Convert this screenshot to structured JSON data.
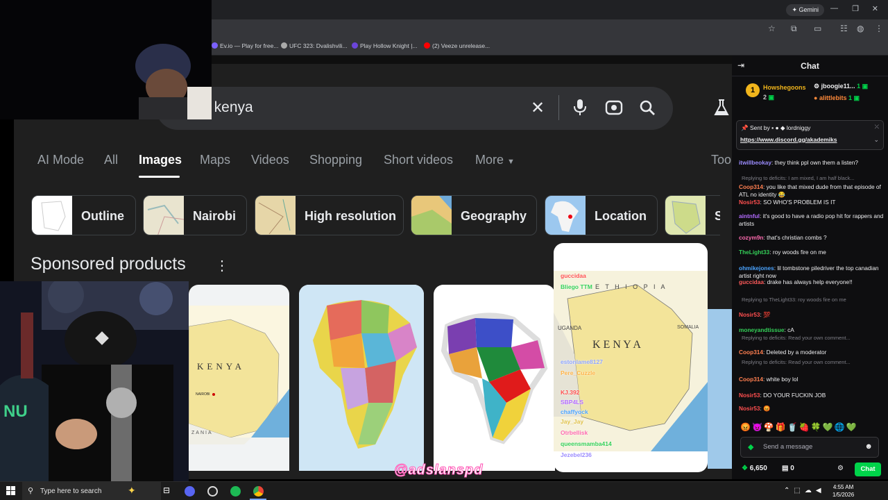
{
  "browser": {
    "gemini_label": "Gemini",
    "bookmarks": [
      {
        "label": "Ev.io — Play for free...",
        "color": "#7b61ff"
      },
      {
        "label": "UFC 323: Dvalishvili...",
        "color": "#aaaaaa"
      },
      {
        "label": "Play Hollow Knight |...",
        "color": "#6b45d9"
      },
      {
        "label": "(2) Veeze unrelease...",
        "color": "#ff0000"
      }
    ]
  },
  "search": {
    "query": "f kenya",
    "tabs": [
      "AI Mode",
      "All",
      "Images",
      "Maps",
      "Videos",
      "Shopping",
      "Short videos",
      "More",
      "Too"
    ],
    "active_tab": "Images",
    "chips": [
      "Outline",
      "Nairobi",
      "High resolution",
      "Geography",
      "Location",
      "Sin"
    ],
    "sponsored_title": "Sponsored products",
    "card_labels": {
      "kenya": "KENYA",
      "kenya_big": "K E N Y A",
      "ethiopia": "E T H I O P I A",
      "uganda": "UGANDA",
      "somalia": "SOMALIA",
      "nairobi": "NAIROBI",
      "tanzania": "ZANIA"
    }
  },
  "chat": {
    "title": "Chat",
    "gifter_top": {
      "rank": "1",
      "name": "Howshegoons",
      "count": "2"
    },
    "gifters_right": [
      {
        "name": "jboogie11...",
        "count": "1"
      },
      {
        "name": "alittlebits",
        "count": "1"
      }
    ],
    "pinned": {
      "sent_by": "Sent by",
      "sender": "lordniggy",
      "link": "https://www.discord.gg/akademiks"
    },
    "messages": [
      {
        "user": "itwillbeokay",
        "color": "#9b8cff",
        "text": "they think ppl own them a listen?"
      },
      {
        "reply": "Replying to deficits: I am mixed, I am half black..."
      },
      {
        "user": "Coop314",
        "color": "#ff7f50",
        "text": "you like that mixed dude from that episode of ATL no identity 😂"
      },
      {
        "user": "Nosir53",
        "color": "#ff4f4f",
        "text": "SO WHO'S PROBLEM IS IT"
      },
      {
        "user": "aintnful",
        "color": "#b36bff",
        "text": "it's good to have a radio pop hit for rappers and artists"
      },
      {
        "user": "cozym9n",
        "color": "#ff6bb0",
        "text": "that's christian combs ?"
      },
      {
        "user": "TheLight33",
        "color": "#34d058",
        "text": "roy woods fire on me"
      },
      {
        "user": "ohmikejones",
        "color": "#4aa3ff",
        "text": "lil tombstone piledriver the top canadian artist right now"
      },
      {
        "user": "guccidaa",
        "color": "#ff5a5a",
        "text": "drake has always help everyone!!"
      },
      {
        "reply": "Replying to TheLight33: roy woods fire on me"
      },
      {
        "user": "Nosir53",
        "color": "#ff4f4f",
        "text": "💯"
      },
      {
        "user": "moneyandtissue",
        "color": "#34d058",
        "text": "cA"
      },
      {
        "reply": "Replying to deficits: Read your own comment..."
      },
      {
        "user": "Coop314",
        "color": "#ff7f50",
        "text": "Deleted by a moderator"
      },
      {
        "reply": "Replying to deficits: Read your own comment..."
      },
      {
        "user": "Coop314",
        "color": "#ff7f50",
        "text": "white boy lol"
      },
      {
        "user": "Nosir53",
        "color": "#ff4f4f",
        "text": "DO YOUR FUCKIN JOB"
      },
      {
        "user": "Nosir53",
        "color": "#ff4f4f",
        "text": "😡"
      }
    ],
    "send_placeholder": "Send a message",
    "points": "6,650",
    "points_right": "0",
    "chat_button": "Chat"
  },
  "overlay_names": [
    "guccidaa",
    "Bliego TTM",
    "estonlame8127",
    "Pere_Cuzzle",
    "KJ.392",
    "SBP4LS",
    "chaffyock",
    "Jay_Jay",
    "Otrbellisk",
    "queensmamba414",
    "Jezebel236"
  ],
  "watermark": "@adslanspd",
  "taskbar": {
    "search_placeholder": "Type here to search",
    "time": "4:55 AM",
    "date": "1/5/2026"
  },
  "colors": {
    "page_bg": "#1f1f1f",
    "chat_bg": "#0e0e10",
    "twitch_green": "#00d34a",
    "taskbar": "#1c1c1c"
  }
}
